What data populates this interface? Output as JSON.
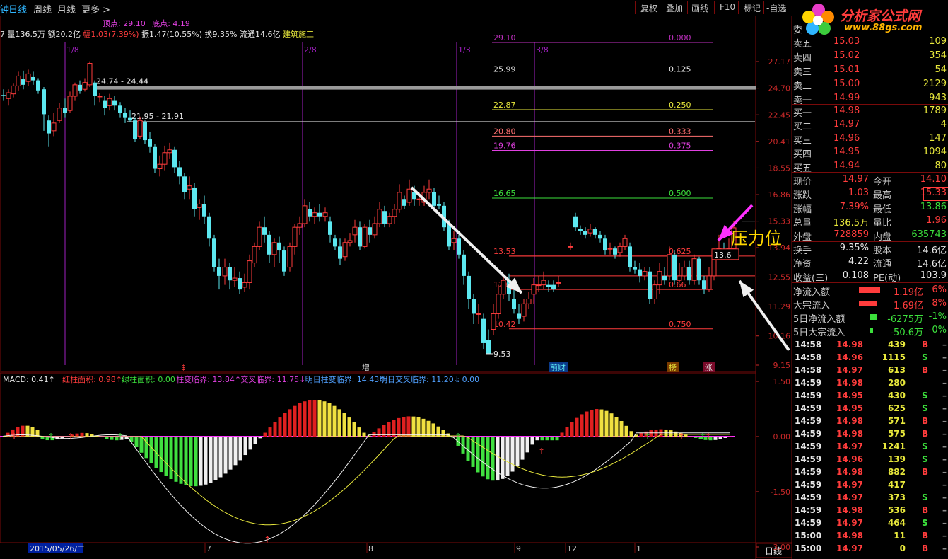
{
  "toolbar": {
    "cut_char": "钟",
    "tabs": [
      "日线",
      "周线",
      "月线",
      "更多 >"
    ],
    "buttons": [
      "复权",
      "叠加",
      "画线",
      "F10",
      "标记",
      "-自选"
    ]
  },
  "info": {
    "top": "顶点: 29.10",
    "bottom": "底点: 4.19",
    "stats": [
      {
        "t": "7 量136.5万",
        "c": "#e6e6e6"
      },
      {
        "t": "额20.2亿",
        "c": "#e6e6e6"
      },
      {
        "t": "幅1.03(7.39%)",
        "c": "#ff3c3c"
      },
      {
        "t": "振1.47(10.55%)",
        "c": "#e6e6e6"
      },
      {
        "t": "换9.35%",
        "c": "#e6e6e6"
      },
      {
        "t": "流通14.6亿",
        "c": "#e6e6e6"
      },
      {
        "t": "建筑施工",
        "c": "#e8e83c"
      }
    ]
  },
  "chart": {
    "y_ticks": [
      "27.17",
      "24.70",
      "22.45",
      "20.41",
      "18.55",
      "16.86",
      "15.33",
      "13.94",
      "12.55",
      "11.29",
      "10.16",
      "9.15"
    ],
    "top_right_ticks": [
      "0.000"
    ],
    "date_marks": [
      "1/8",
      "2/8",
      "1/3",
      "3/8"
    ],
    "levels": [
      {
        "left": "29.10",
        "right": "0.000",
        "color": "#c030c0"
      },
      {
        "left": "25.99",
        "right": "0.125",
        "color": "#e6e6e6"
      },
      {
        "left": "22.87",
        "right": "0.250",
        "color": "#e8e83c"
      },
      {
        "left": "20.80",
        "right": "0.333",
        "color": "#ff7070"
      },
      {
        "left": "19.76",
        "right": "0.375",
        "color": "#e040e0"
      },
      {
        "left": "16.65",
        "right": "0.500",
        "color": "#3ce03c"
      },
      {
        "left": "13.53",
        "right": "0.625",
        "color": "#ff3c3c"
      },
      {
        "left": "12.0",
        "right": "0.66",
        "color": "#ff3c3c"
      },
      {
        "left": "10.42",
        "right": "0.750",
        "color": "#ff3c3c"
      }
    ],
    "range_labels": [
      "24.74 - 24.44",
      "21.95 - 21.91"
    ],
    "low_label": "9.53",
    "price_label": "13.6",
    "pressure_label": "压力位",
    "event_tags": [
      "$",
      "增",
      "前财",
      "榜",
      "涨"
    ]
  },
  "macd": {
    "items": [
      {
        "t": "MACD: 0.41↑",
        "c": "#e6e6e6"
      },
      {
        "t": "红柱面积: 0.98↑",
        "c": "#ff3c3c"
      },
      {
        "t": "绿柱面积: 0.00",
        "c": "#3ce03c"
      },
      {
        "t": "柱变临界: 13.84↑",
        "c": "#e040e0"
      },
      {
        "t": "交叉临界: 11.75↓",
        "c": "#e040e0"
      },
      {
        "t": "明日柱变临界: 14.43↑",
        "c": "#50a0ff"
      },
      {
        "t": "明日交叉临界: 11.20↓",
        "c": "#50a0ff"
      },
      {
        "t": ": 0.00",
        "c": "#50a0ff"
      }
    ],
    "y_ticks": [
      "1.50",
      "0.00",
      "-1.50",
      "-3.00"
    ]
  },
  "bottom_axis": {
    "date": "2015/05/26/二",
    "months": [
      "7",
      "8",
      "9",
      "12",
      "1"
    ],
    "period": "日线"
  },
  "logo": {
    "title": "分析家公式网",
    "url": "www.88gs.com"
  },
  "quote": {
    "header": "委",
    "asks": [
      {
        "l": "卖五",
        "p": "15.03",
        "v": "109"
      },
      {
        "l": "卖四",
        "p": "15.02",
        "v": "354"
      },
      {
        "l": "卖三",
        "p": "15.01",
        "v": "54"
      },
      {
        "l": "卖二",
        "p": "15.00",
        "v": "2129"
      },
      {
        "l": "卖一",
        "p": "14.99",
        "v": "943"
      }
    ],
    "bids": [
      {
        "l": "买一",
        "p": "14.98",
        "v": "1789"
      },
      {
        "l": "买二",
        "p": "14.97",
        "v": "4"
      },
      {
        "l": "买三",
        "p": "14.96",
        "v": "147"
      },
      {
        "l": "买四",
        "p": "14.95",
        "v": "1094"
      },
      {
        "l": "买五",
        "p": "14.94",
        "v": "80"
      }
    ],
    "stats": [
      {
        "l": "现价",
        "v": "14.97",
        "vc": "#ff3c3c",
        "l2": "今开",
        "v2": "14.10",
        "v2c": "#ff3c3c"
      },
      {
        "l": "涨跌",
        "v": "1.03",
        "vc": "#ff3c3c",
        "l2": "最高",
        "v2": "15.33",
        "v2c": "#ff3c3c"
      },
      {
        "l": "涨幅",
        "v": "7.39%",
        "vc": "#ff3c3c",
        "l2": "最低",
        "v2": "13.86",
        "v2c": "#3ce03c"
      },
      {
        "l": "总量",
        "v": "136.5万",
        "vc": "#e8e83c",
        "l2": "量比",
        "v2": "1.96",
        "v2c": "#ff3c3c"
      },
      {
        "l": "外盘",
        "v": "728859",
        "vc": "#ff3c3c",
        "l2": "内盘",
        "v2": "635743",
        "v2c": "#3ce03c"
      }
    ],
    "stats2": [
      {
        "l": "换手",
        "v": "9.35%",
        "l2": "股本",
        "v2": "14.6亿"
      },
      {
        "l": "净资",
        "v": "4.22",
        "l2": "流通",
        "v2": "14.6亿"
      },
      {
        "l": "收益(三)",
        "v": "0.108",
        "l2": "PE(动)",
        "v2": "103.9"
      }
    ],
    "flows": [
      {
        "l": "净流入额",
        "v": "1.19亿",
        "p": "6%",
        "c": "#ff3c3c"
      },
      {
        "l": "大宗流入",
        "v": "1.69亿",
        "p": "8%",
        "c": "#ff3c3c"
      },
      {
        "l": "5日净流入额",
        "v": "-6275万",
        "p": "-1%",
        "c": "#3ce03c"
      },
      {
        "l": "5日大宗流入",
        "v": "-50.6万",
        "p": "-0%",
        "c": "#3ce03c"
      }
    ]
  },
  "ticks": [
    {
      "t": "14:58",
      "p": "14.98",
      "v": "439",
      "d": "B"
    },
    {
      "t": "14:58",
      "p": "14.96",
      "v": "1115",
      "d": "S"
    },
    {
      "t": "14:58",
      "p": "14.97",
      "v": "613",
      "d": "B"
    },
    {
      "t": "14:59",
      "p": "14.98",
      "v": "280",
      "d": ""
    },
    {
      "t": "14:59",
      "p": "14.95",
      "v": "430",
      "d": "S"
    },
    {
      "t": "14:59",
      "p": "14.95",
      "v": "625",
      "d": "S"
    },
    {
      "t": "14:59",
      "p": "14.98",
      "v": "571",
      "d": "B"
    },
    {
      "t": "14:59",
      "p": "14.98",
      "v": "575",
      "d": "B"
    },
    {
      "t": "14:59",
      "p": "14.97",
      "v": "1241",
      "d": "S"
    },
    {
      "t": "14:59",
      "p": "14.96",
      "v": "139",
      "d": "S"
    },
    {
      "t": "14:59",
      "p": "14.98",
      "v": "882",
      "d": "B"
    },
    {
      "t": "14:59",
      "p": "14.97",
      "v": "417",
      "d": ""
    },
    {
      "t": "14:59",
      "p": "14.97",
      "v": "373",
      "d": "S"
    },
    {
      "t": "14:59",
      "p": "14.98",
      "v": "536",
      "d": "B"
    },
    {
      "t": "14:59",
      "p": "14.97",
      "v": "464",
      "d": "S"
    },
    {
      "t": "15:00",
      "p": "14.98",
      "v": "11",
      "d": "B"
    },
    {
      "t": "15:00",
      "p": "14.97",
      "v": "0",
      "d": "B"
    }
  ]
}
